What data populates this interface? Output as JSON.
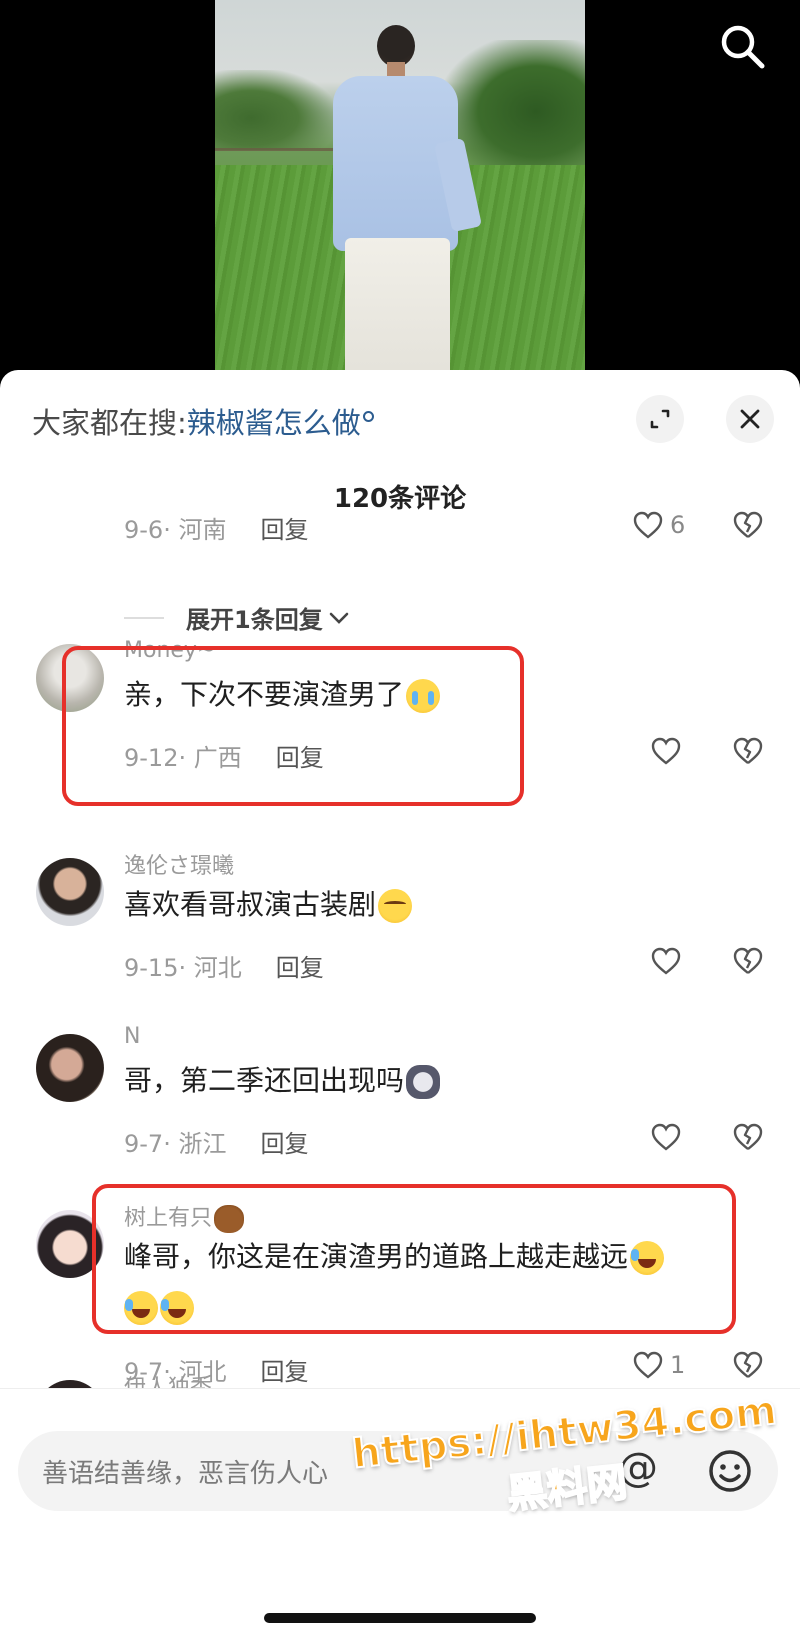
{
  "header": {
    "trending_label": "大家都在搜:",
    "trending_query": "辣椒酱怎么做",
    "comment_count": "120条评论"
  },
  "prev_comment": {
    "date": "9-6",
    "location": "河南",
    "reply_label": "回复",
    "likes": "6"
  },
  "expand_replies": {
    "label": "展开1条回复"
  },
  "comments": [
    {
      "username": "Money~",
      "text": "亲，下次不要演渣男了",
      "emoji": "loudly-crying-face",
      "date": "9-12",
      "location": "广西",
      "reply_label": "回复",
      "likes": ""
    },
    {
      "username": "逸伦さ璟曦",
      "text": "喜欢看哥叔演古装剧",
      "emoji": "relieved-face",
      "date": "9-15",
      "location": "河北",
      "reply_label": "回复",
      "likes": ""
    },
    {
      "username": "N",
      "text": "哥，第二季还回出现吗",
      "emoji": "cat-face",
      "date": "9-7",
      "location": "浙江",
      "reply_label": "回复",
      "likes": ""
    },
    {
      "username": "树上有只",
      "username_emoji": "bear-face",
      "text_line1": "峰哥，你这是在演渣男的道路上越走越远",
      "emoji": "rolling-on-floor-laughing",
      "date": "9-7",
      "location": "河北",
      "reply_label": "回复",
      "likes": "1"
    },
    {
      "username": "伊人独秀"
    }
  ],
  "composer": {
    "placeholder": "善语结善缘，恶言伤人心",
    "at_symbol": "@"
  },
  "watermark": {
    "url": "https://ihtw34.com",
    "name": "黑料网"
  },
  "icons": {
    "search": "search-icon",
    "expand": "fullscreen-icon",
    "close": "close-icon",
    "like": "heart-icon",
    "dislike": "broken-heart-icon",
    "emoji_picker": "smiley-icon"
  },
  "colors": {
    "highlight": "#e6302a",
    "link": "#2c5c8f",
    "watermark": "#f7a51c"
  }
}
